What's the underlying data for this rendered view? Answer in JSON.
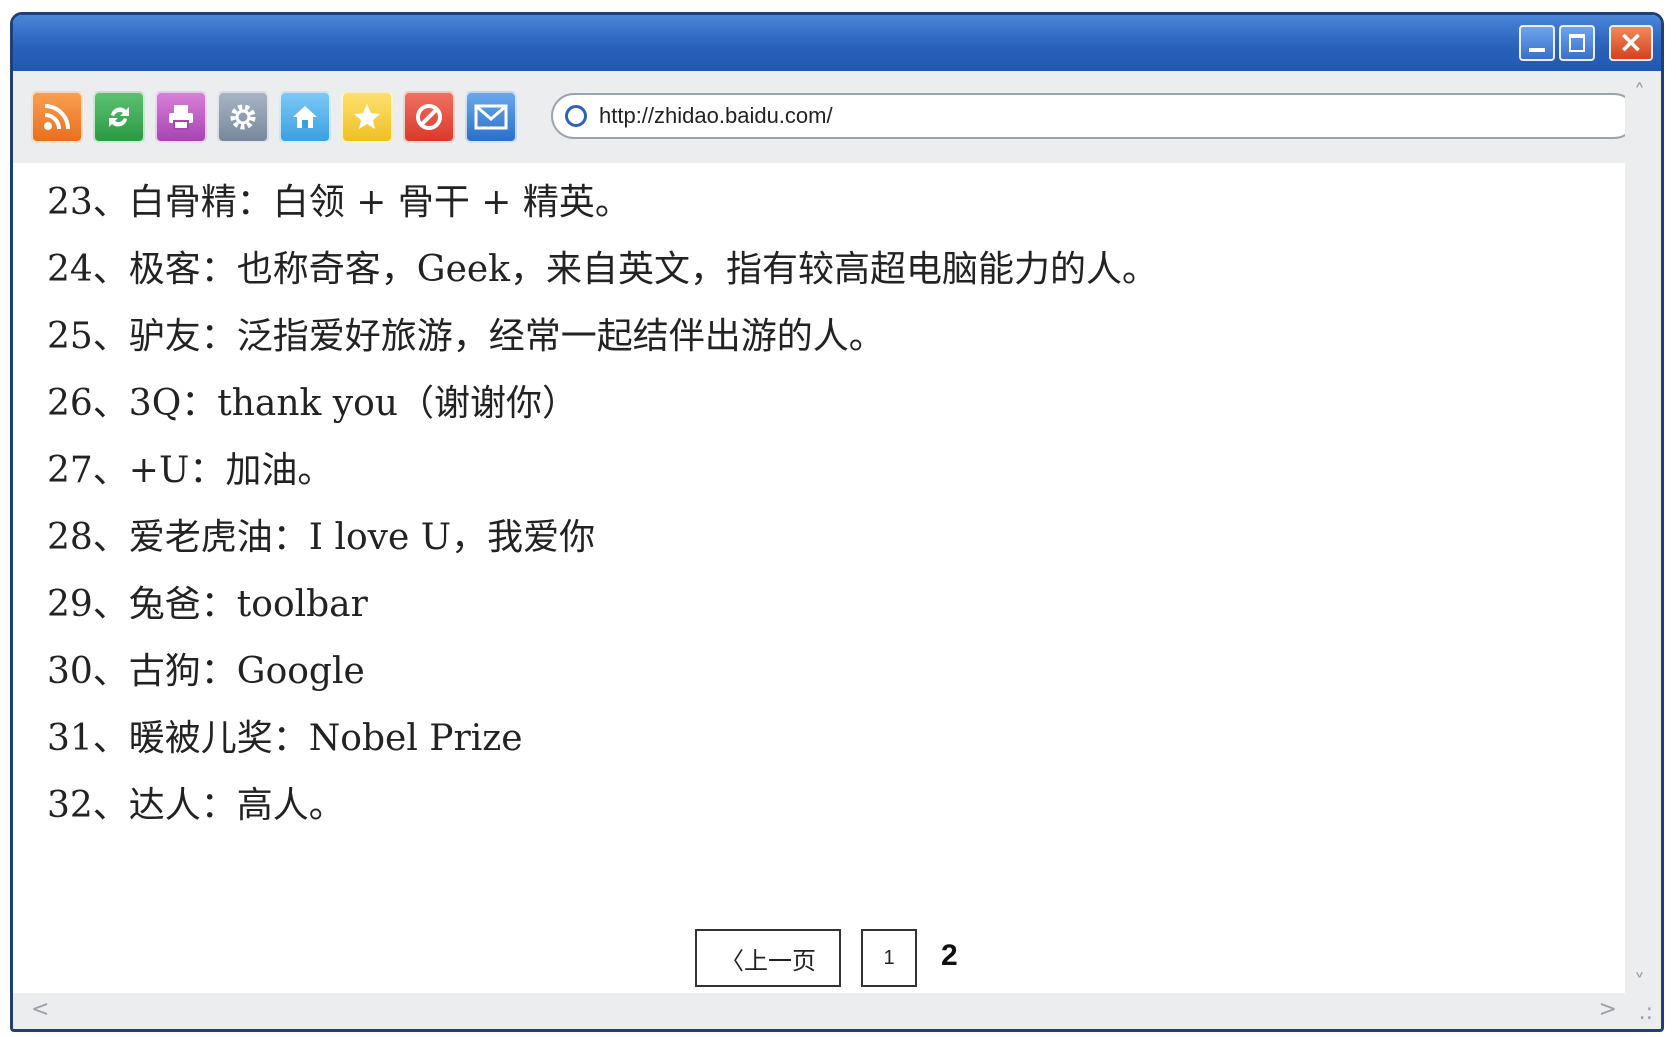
{
  "browser": {
    "address_url": "http://zhidao.baidu.com/",
    "toolbar_icons": [
      "rss-icon",
      "refresh-icon",
      "print-icon",
      "settings-icon",
      "home-icon",
      "favorites-icon",
      "stop-icon",
      "mail-icon"
    ]
  },
  "content": {
    "lines": [
      "23、白骨精：白领 + 骨干 + 精英。",
      "24、极客：也称奇客，Geek，来自英文，指有较高超电脑能力的人。",
      "25、驴友：泛指爱好旅游，经常一起结伴出游的人。",
      "26、3Q：thank you（谢谢你）",
      "27、+U：加油。",
      "28、爱老虎油：I love U，我爱你",
      "29、兔爸：toolbar",
      "30、古狗：Google",
      "31、暖被儿奖：Nobel Prize",
      "32、达人：高人。"
    ]
  },
  "pager": {
    "prev_label": "〈上一页",
    "page1": "1",
    "current": "2"
  },
  "scroll": {
    "up": "˄",
    "down": "˅",
    "left": "<",
    "right": ">",
    "grip": ".:"
  }
}
